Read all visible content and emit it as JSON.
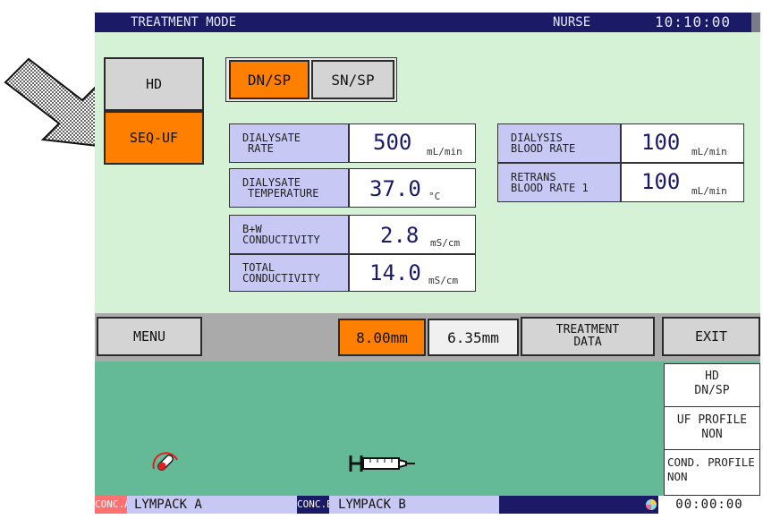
{
  "header": {
    "mode": "TREATMENT MODE",
    "user": "NURSE",
    "clock": "10:10:00"
  },
  "treatment_type": {
    "hd": "HD",
    "seq_uf": "SEQ-UF"
  },
  "needle_mode": {
    "dn_sp": "DN/SP",
    "sn_sp": "SN/SP"
  },
  "params": {
    "dialysate_rate": {
      "label1": "DIALYSATE",
      "label2": "RATE",
      "value": "500",
      "unit": "mL/min"
    },
    "dialysate_temperature": {
      "label1": "DIALYSATE",
      "label2": "TEMPERATURE",
      "value": "37.0",
      "unit": "°C"
    },
    "bw_conductivity": {
      "label1": "B+W",
      "label2": "CONDUCTIVITY",
      "value": "2.8",
      "unit": "mS/cm"
    },
    "total_conductivity": {
      "label1": "TOTAL",
      "label2": "CONDUCTIVITY",
      "value": "14.0",
      "unit": "mS/cm"
    },
    "dialysis_blood_rate": {
      "label1": "DIALYSIS",
      "label2": "BLOOD RATE",
      "value": "100",
      "unit": "mL/min"
    },
    "retrans_blood_rate": {
      "label1": "RETRANS",
      "label2": "BLOOD RATE 1",
      "value": "100",
      "unit": "mL/min"
    }
  },
  "menu_bar": {
    "menu": "MENU",
    "size_a": "8.00mm",
    "size_b": "6.35mm",
    "treat_data_1": "TREATMENT",
    "treat_data_2": "DATA",
    "exit": "EXIT"
  },
  "side_panel": {
    "hd": "HD",
    "dn_sp": "DN/SP",
    "uf_profile": "UF PROFILE",
    "uf_profile_val": "NON",
    "cond_profile": "COND. PROFILE",
    "cond_profile_val": "NON"
  },
  "status_bar": {
    "conc_a_tag": "CONC.A",
    "conc_a": "LYMPACK A",
    "conc_b_tag": "CONC.B",
    "conc_b": "LYMPACK B",
    "timer": "00:00:00"
  },
  "icons": {
    "arrow": "pointer-arrow-icon",
    "pressure": "pressure-gauge-icon",
    "syringe": "syringe-icon",
    "status": "multicolor-status-icon"
  },
  "colors": {
    "header": "#1a1a66",
    "panel": "#d6f2d6",
    "lower": "#64ba96",
    "selected": "#ff7f00",
    "label": "#c8c8f4"
  }
}
